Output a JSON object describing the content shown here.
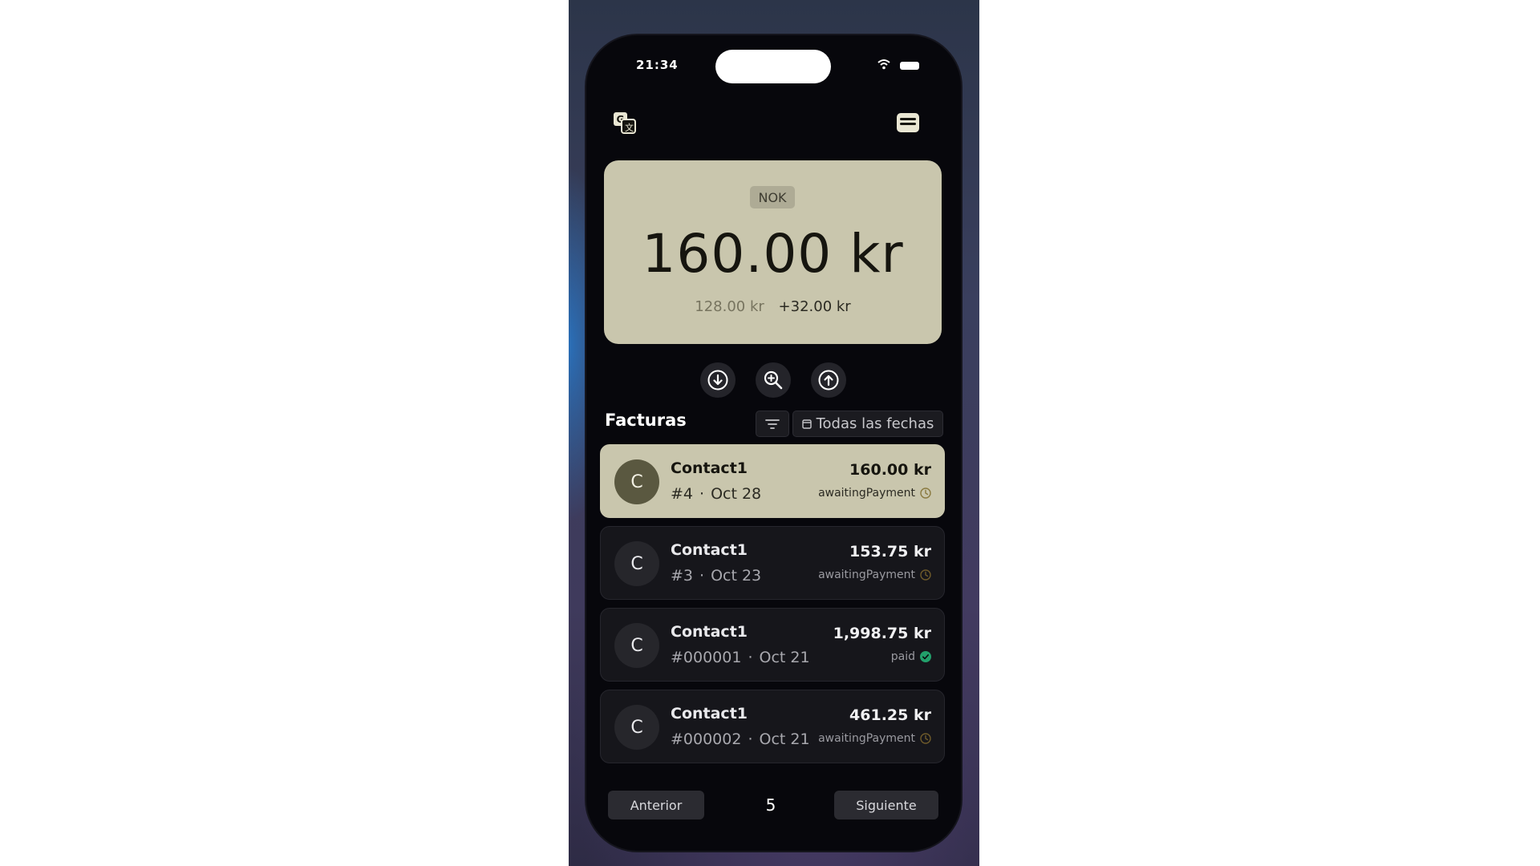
{
  "status_bar": {
    "time": "21:34"
  },
  "icons": {
    "translate": "translate-icon",
    "menu": "card-menu-icon",
    "download": "download-icon",
    "search": "search-zoom-icon",
    "upload": "upload-icon",
    "filter": "filter-icon",
    "calendar": "calendar-icon"
  },
  "colors": {
    "accent_card": "#c9c6ad",
    "background": "#07070c",
    "pending": "#c7a34a",
    "paid": "#22a06b"
  },
  "summary": {
    "currency": "NOK",
    "total": "160.00 kr",
    "base": "128.00 kr",
    "tax": "+32.00 kr"
  },
  "invoices": {
    "title": "Facturas",
    "date_filter": "Todas las fechas",
    "items": [
      {
        "avatar": "C",
        "contact": "Contact1",
        "number": "#4",
        "date": "Oct 28",
        "amount": "160.00 kr",
        "status": "awaitingPayment"
      },
      {
        "avatar": "C",
        "contact": "Contact1",
        "number": "#3",
        "date": "Oct 23",
        "amount": "153.75 kr",
        "status": "awaitingPayment"
      },
      {
        "avatar": "C",
        "contact": "Contact1",
        "number": "#000001",
        "date": "Oct 21",
        "amount": "1,998.75 kr",
        "status": "paid"
      },
      {
        "avatar": "C",
        "contact": "Contact1",
        "number": "#000002",
        "date": "Oct 21",
        "amount": "461.25 kr",
        "status": "awaitingPayment"
      }
    ]
  },
  "pagination": {
    "prev": "Anterior",
    "page": "5",
    "next": "Siguiente"
  }
}
